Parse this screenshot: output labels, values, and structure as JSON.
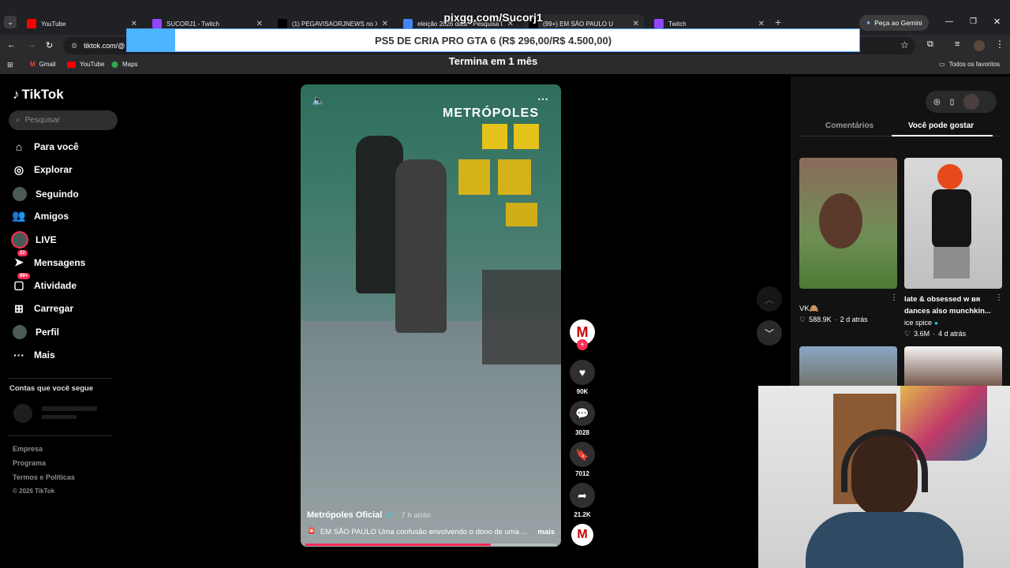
{
  "browser": {
    "tabs": [
      {
        "label": "YouTube",
        "color": "#ff0000"
      },
      {
        "label": "SUCORJ1 - Twitch",
        "color": "#9146ff"
      },
      {
        "label": "(1) PEGAVISAORJNEWS no X: \"",
        "color": "#000000"
      },
      {
        "label": "eleição 2026 data - Pesquisa Go",
        "color": "#4285f4"
      },
      {
        "label": "(99+) EM SÃO PAULO U",
        "color": "#000000"
      },
      {
        "label": "Twitch",
        "color": "#9146ff"
      }
    ],
    "gemini_label": "Peça ao Gemini",
    "url": "tiktok.com/@",
    "bookmarks": [
      "Gmail",
      "YouTube",
      "Maps"
    ],
    "favorites_label": "Todos os favoritos"
  },
  "overlay": {
    "site": "pixgg.com/Sucorj1",
    "banner": "PS5 DE CRIA PRO GTA 6 (R$ 296,00/R$ 4.500,00)",
    "timer": "Termina em 1 mês",
    "progress_fraction": 0.066
  },
  "sidebar": {
    "logo": "TikTok",
    "search_placeholder": "Pesquisar",
    "nav": [
      {
        "label": "Para você",
        "icon": "home-icon"
      },
      {
        "label": "Explorar",
        "icon": "compass-icon"
      },
      {
        "label": "Seguindo",
        "icon": "avatar-icon"
      },
      {
        "label": "Amigos",
        "icon": "friends-icon"
      },
      {
        "label": "LIVE",
        "icon": "live-avatar-icon"
      },
      {
        "label": "Mensagens",
        "icon": "messages-icon",
        "badge": "22"
      },
      {
        "label": "Atividade",
        "icon": "activity-icon",
        "badge": "99+"
      },
      {
        "label": "Carregar",
        "icon": "upload-icon"
      },
      {
        "label": "Perfil",
        "icon": "profile-icon"
      },
      {
        "label": "Mais",
        "icon": "more-icon"
      }
    ],
    "following_header": "Contas que você segue",
    "footer": [
      "Empresa",
      "Programa",
      "Termos e Políticas",
      "© 2026 TikTok"
    ]
  },
  "video": {
    "watermark": "METRÓPOLES",
    "author": "Metrópoles Oficial",
    "time": "· 7 h atrás",
    "caption": "EM SÃO PAULO Uma confusão envolvendo o dono de uma ...",
    "more": "mais",
    "progress_fraction": 0.74,
    "likes": "90K",
    "comments": "3028",
    "saves": "7012",
    "shares": "21.2K"
  },
  "panel": {
    "tabs": [
      "Comentários",
      "Você pode gostar"
    ],
    "active_tab": 1,
    "suggestions": [
      {
        "title": "VK🙈",
        "likes": "588.9K",
        "age": "2 d atrás",
        "author": ""
      },
      {
        "title": "late & obsessed w ʙʀ dances also munchkin...",
        "likes": "3.6M",
        "age": "4 d atrás",
        "author": "ice spice"
      }
    ]
  }
}
